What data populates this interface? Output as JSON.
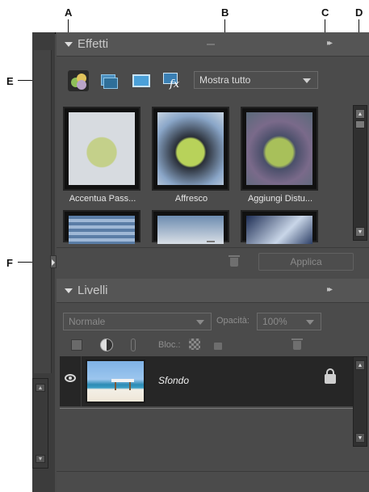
{
  "callouts": {
    "a": "A",
    "b": "B",
    "c": "C",
    "d": "D",
    "e": "E",
    "f": "F"
  },
  "effects_panel": {
    "title": "Effetti",
    "filter_select": "Mostra tutto",
    "thumbs": [
      {
        "label": "Accentua Pass..."
      },
      {
        "label": "Affresco"
      },
      {
        "label": "Aggiungi Distu..."
      }
    ],
    "apply_button": "Applica"
  },
  "layers_panel": {
    "title": "Livelli",
    "blend_mode": "Normale",
    "opacity_label": "Opacità:",
    "opacity_value": "100%",
    "lock_label": "Bloc.:",
    "layer": {
      "name": "Sfondo"
    }
  },
  "icons": {
    "expand": "triangle-down-icon",
    "panel_menu": "double-chevron-right-icon",
    "visibility": "eye-icon",
    "lock": "lock-icon",
    "delete": "trash-icon"
  }
}
